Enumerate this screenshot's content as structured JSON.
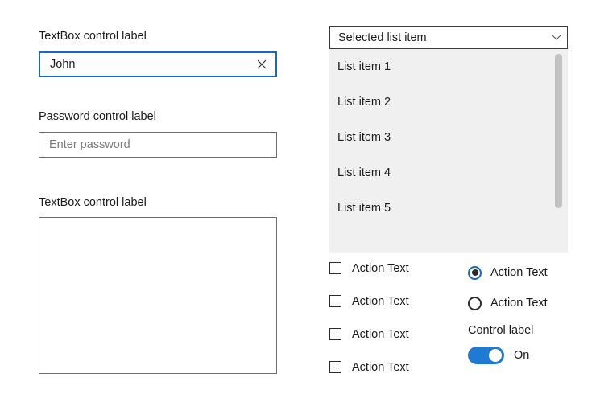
{
  "left_panel": {
    "textbox": {
      "label": "TextBox control label",
      "value": "John",
      "clear_icon": "close-icon"
    },
    "password": {
      "label": "Password control label",
      "placeholder": "Enter password",
      "value": ""
    },
    "multiline": {
      "label": "TextBox control label",
      "value": ""
    }
  },
  "right_panel": {
    "combobox": {
      "selected": "Selected list item",
      "chevron_icon": "chevron-down-icon",
      "items": [
        "List item 1",
        "List item 2",
        "List item 3",
        "List item 4",
        "List item 5"
      ]
    },
    "checkboxes": [
      {
        "label": "Action Text",
        "checked": false
      },
      {
        "label": "Action Text",
        "checked": false
      },
      {
        "label": "Action Text",
        "checked": false
      },
      {
        "label": "Action Text",
        "checked": false
      }
    ],
    "radios": [
      {
        "label": "Action Text",
        "selected": true
      },
      {
        "label": "Action Text",
        "selected": false
      }
    ],
    "toggle": {
      "label": "Control label",
      "state": "On",
      "on": true
    }
  },
  "colors": {
    "accent_blue": "#1f7ad4",
    "focus_border": "#1668c1",
    "border_gray": "#6e6e6e",
    "border_dark": "#3b3b3b",
    "list_background": "#f0f0f0",
    "scrollbar_thumb": "#c2c2c2",
    "text": "#1b1b1b",
    "placeholder": "#7a7a7a"
  }
}
